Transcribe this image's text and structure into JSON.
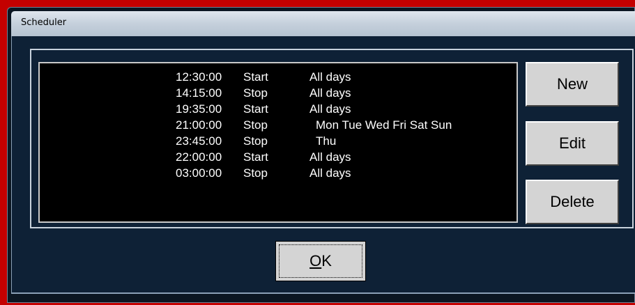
{
  "window": {
    "title": "Scheduler"
  },
  "schedule": [
    {
      "time": "12:30:00",
      "action": "Start",
      "days": "All days"
    },
    {
      "time": "14:15:00",
      "action": "Stop",
      "days": "All days"
    },
    {
      "time": "19:35:00",
      "action": "Start",
      "days": "All days"
    },
    {
      "time": "21:00:00",
      "action": "Stop",
      "days": "Mon Tue Wed Fri Sat Sun"
    },
    {
      "time": "23:45:00",
      "action": "Stop",
      "days": "Thu"
    },
    {
      "time": "22:00:00",
      "action": "Start",
      "days": "All days"
    },
    {
      "time": "03:00:00",
      "action": "Stop",
      "days": "All days"
    }
  ],
  "buttons": {
    "new_label": "New",
    "edit_label": "Edit",
    "delete_label": "Delete",
    "ok_label_mnemonic": "O",
    "ok_label_rest": "K"
  },
  "colors": {
    "frame": "#c40000",
    "list_bg": "#000000",
    "client_bg": "#0e2136",
    "button_bg": "#d4d4d4"
  }
}
